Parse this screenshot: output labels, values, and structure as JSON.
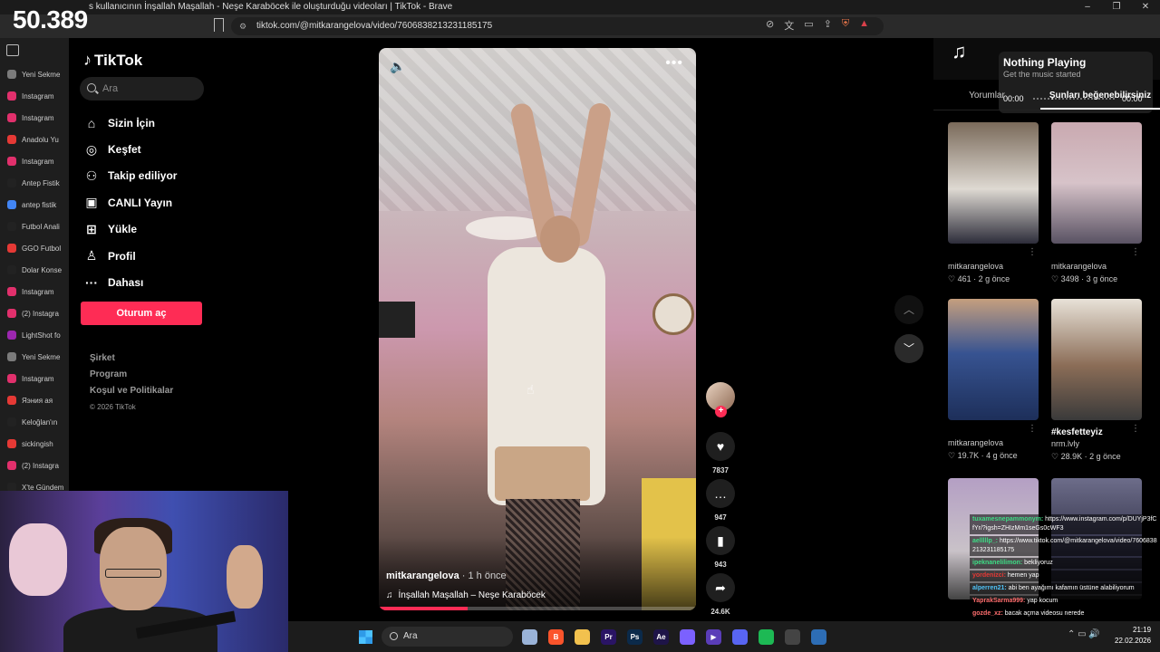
{
  "stream_counter": "50.389",
  "window": {
    "title": "s kullanıcının İnşallah Maşallah - Neşe Karaböcek ile oluşturduğu videoları | TikTok - Brave",
    "controls": [
      "–",
      "❐",
      "✕"
    ]
  },
  "address_bar": {
    "url": "tiktok.com/@mitkarangelova/video/7606838213231185175"
  },
  "tabs": [
    {
      "label": "Yeni Sekme",
      "color": "#7b7b7b"
    },
    {
      "label": "Instagram",
      "color": "#e1306c"
    },
    {
      "label": "Instagram",
      "color": "#e1306c"
    },
    {
      "label": "Anadolu Yu",
      "color": "#e53935"
    },
    {
      "label": "Instagram",
      "color": "#e1306c"
    },
    {
      "label": "Antep Fistik",
      "color": "#222222"
    },
    {
      "label": "antep fistik",
      "color": "#4285f4"
    },
    {
      "label": "Futbol Anali",
      "color": "#222222"
    },
    {
      "label": "GGO Futbol",
      "color": "#e53935"
    },
    {
      "label": "Dolar Konse",
      "color": "#222222"
    },
    {
      "label": "Instagram",
      "color": "#e1306c"
    },
    {
      "label": "(2) Instagra",
      "color": "#e1306c"
    },
    {
      "label": "LightShot fo",
      "color": "#9c27b0"
    },
    {
      "label": "Yeni Sekme",
      "color": "#7b7b7b"
    },
    {
      "label": "Instagram",
      "color": "#e1306c"
    },
    {
      "label": "Яэния ая",
      "color": "#e53935"
    },
    {
      "label": "Keloğlan'ın",
      "color": "#222222"
    },
    {
      "label": "sickingish",
      "color": "#e53935"
    },
    {
      "label": "(2) Instagra",
      "color": "#e1306c"
    },
    {
      "label": "X'te Gündem",
      "color": "#222222"
    }
  ],
  "tiktok": {
    "logo": "TikTok",
    "search_placeholder": "Ara",
    "nav": [
      {
        "icon": "home-icon",
        "glyph": "⌂",
        "label": "Sizin İçin"
      },
      {
        "icon": "compass-icon",
        "glyph": "◎",
        "label": "Keşfet"
      },
      {
        "icon": "following-icon",
        "glyph": "⚇",
        "label": "Takip ediliyor"
      },
      {
        "icon": "live-icon",
        "glyph": "▣",
        "label": "CANLI Yayın"
      },
      {
        "icon": "upload-icon",
        "glyph": "⊞",
        "label": "Yükle"
      },
      {
        "icon": "profile-icon",
        "glyph": "♙",
        "label": "Profil"
      },
      {
        "icon": "more-icon",
        "glyph": "···",
        "label": "Dahası"
      }
    ],
    "login_button": "Oturum aç",
    "footer": {
      "company": "Şirket",
      "program": "Program",
      "terms": "Koşul ve Politikalar",
      "copyright": "© 2026 TikTok"
    }
  },
  "video": {
    "author": "mitkarangelova",
    "time": " · 1 h önce",
    "music": "İnşallah Maşallah – Neşe Karaböcek",
    "progress_fraction": 0.28
  },
  "actions": {
    "likes": "7837",
    "comments": "947",
    "saves": "943",
    "shares": "24.6K"
  },
  "now_playing": {
    "title": "Nothing Playing",
    "subtitle": "Get the music started",
    "time_start": "00:00",
    "time_end": "00:00"
  },
  "right_tabs": {
    "comments": "Yorumlar",
    "suggested": "Şunları beğenebilirsiniz"
  },
  "cards": [
    {
      "user": "mitkarangelova",
      "stats": "♡ 461 · 2 g önce",
      "bg": "linear-gradient(180deg,#7a6a5a,#ded9d2 55%,#2d2d3a)"
    },
    {
      "user": "mitkarangelova",
      "stats": "♡ 3498 · 3 g önce",
      "bg": "linear-gradient(180deg,#c9a9b0,#d7c3c9 50%,#595263)"
    },
    {
      "user": "mitkarangelova",
      "stats": "♡ 19.7K · 4 g önce",
      "bg": "linear-gradient(180deg,#c59f7e,#375391 45%,#1d2f5a)"
    },
    {
      "title": "#kesfetteyiz",
      "user": "nrm.lvly",
      "stats": "♡ 28.9K · 2 g önce",
      "bg": "linear-gradient(180deg,#e8e2d8,#8b6d57 55%,#3a3a3a)"
    },
    {
      "user": "",
      "stats": "",
      "bg": "linear-gradient(180deg,#b49fc4,#c9c2c8 60%,#444)"
    },
    {
      "user": "",
      "stats": "",
      "bg": "linear-gradient(180deg,#6d6d8a,#2f2f45 60%,#111)"
    }
  ],
  "chat": [
    {
      "user": "tuxamesnepammonym:",
      "text": " https://www.instagram.com/p/DUYjP3fCfYr/?igsh=ZHIzMm1seGs0cWF3",
      "color": "#3ddc84"
    },
    {
      "user": "aelllllp_:",
      "text": " https://www.tiktok.com/@mitkarangelova/video/7606838213231185175",
      "color": "#3ddc84"
    },
    {
      "user": "ipeknanelilimon:",
      "text": " bekliyoruz",
      "color": "#3ddc84"
    },
    {
      "user": "yordenizci:",
      "text": " hemen yap",
      "color": "#e53935"
    },
    {
      "user": "alperren21:",
      "text": " abi ben ayağımı kafamın üstüne alabiliyorum",
      "color": "#4fc3f7"
    },
    {
      "user": "YaprakSarma999:",
      "text": " yap kocum",
      "color": "#ff6e6e"
    },
    {
      "user": "gozde_xz:",
      "text": " bacak açma videosu nerede",
      "color": "#ff6e6e"
    }
  ],
  "taskbar": {
    "search_placeholder": "Ara",
    "apps": [
      {
        "label": "",
        "color": "#9ab3d8"
      },
      {
        "label": "B",
        "color": "#fb542b"
      },
      {
        "label": "",
        "color": "#f2c14e"
      },
      {
        "label": "Pr",
        "color": "#2a1464"
      },
      {
        "label": "Ps",
        "color": "#0b2a4a"
      },
      {
        "label": "Ae",
        "color": "#1e1448"
      },
      {
        "label": "",
        "color": "#7b61ff"
      },
      {
        "label": "▶",
        "color": "#5a3db8"
      },
      {
        "label": "",
        "color": "#5865f2"
      },
      {
        "label": "",
        "color": "#1db954"
      },
      {
        "label": "",
        "color": "#444444"
      },
      {
        "label": "",
        "color": "#2d6db5"
      }
    ],
    "tray": "⌃  ▭  🔊",
    "time": "21:19",
    "date": "22.02.2026"
  }
}
